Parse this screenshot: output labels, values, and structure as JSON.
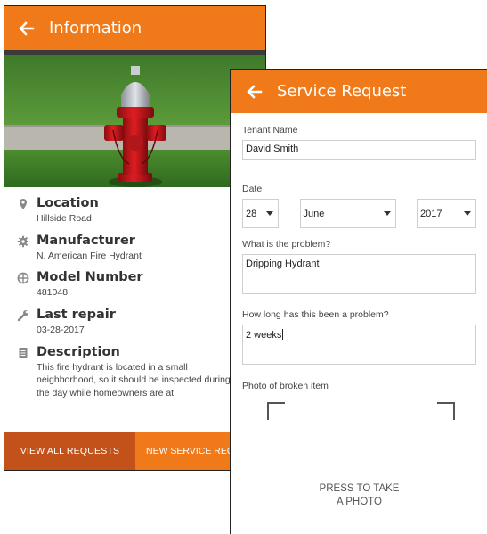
{
  "info_screen": {
    "title": "Information",
    "items": [
      {
        "icon": "location-pin-icon",
        "label": "Location",
        "value": "Hillside Road"
      },
      {
        "icon": "gear-icon",
        "label": "Manufacturer",
        "value": "N. American Fire Hydrant"
      },
      {
        "icon": "globe-icon",
        "label": "Model Number",
        "value": "481048"
      },
      {
        "icon": "wrench-icon",
        "label": "Last repair",
        "value": "03-28-2017"
      },
      {
        "icon": "document-icon",
        "label": "Description",
        "value": "This fire hydrant is located in a small neighborhood, so it should be inspected during the day while homeowners are at"
      }
    ],
    "buttons": {
      "view_all": "VIEW ALL REQUESTS",
      "new_request": "NEW SERVICE REQ"
    }
  },
  "service_request_screen": {
    "title": "Service Request",
    "tenant_label": "Tenant Name",
    "tenant_value": "David Smith",
    "date_label": "Date",
    "date_day": "28",
    "date_month": "June",
    "date_year": "2017",
    "problem_label": "What is the problem?",
    "problem_value": "Dripping Hydrant",
    "duration_label": "How long has this been a problem?",
    "duration_value": "2 weeks",
    "photo_label": "Photo of broken item",
    "take_photo_line1": "PRESS TO TAKE",
    "take_photo_line2": "A PHOTO"
  },
  "colors": {
    "accent": "#f07a1a",
    "accent_dark": "#c2521a"
  }
}
